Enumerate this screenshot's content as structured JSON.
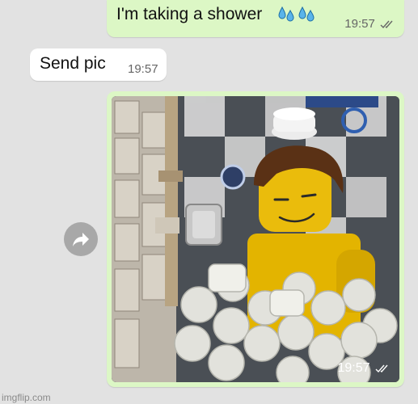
{
  "messages": {
    "outgoing_1": {
      "text": "I'm taking a shower",
      "time": "19:57",
      "status": "read-double-check"
    },
    "incoming_1": {
      "text": "Send pic",
      "time": "19:57"
    },
    "outgoing_image": {
      "time": "19:57",
      "status": "read-double-check"
    }
  },
  "watermark": "imgflip.com",
  "colors": {
    "outgoing_bubble": "#dcf7c5",
    "incoming_bubble": "#ffffff",
    "background": "#e2e2e2"
  },
  "icons": [
    "sweat-droplets-icon",
    "double-check-icon",
    "forward-icon"
  ]
}
